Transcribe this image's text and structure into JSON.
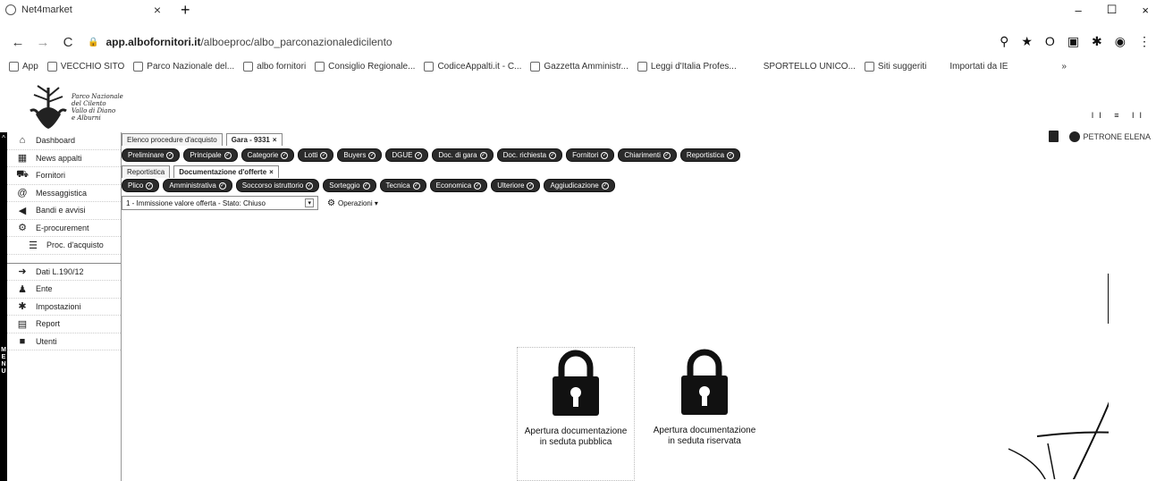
{
  "browser": {
    "tab_title": "Net4market",
    "tab_close": "×",
    "new_tab": "+",
    "url_host": "app.albofornitori.it",
    "url_path": "/alboeproc/albo_parconazionaledicilento",
    "window_controls": [
      "–",
      "☐",
      "×"
    ],
    "extensions": [
      "search-icon",
      "star-icon",
      "opera-icon",
      "ext-icon",
      "puzzle-icon",
      "profile-icon",
      "kebab-icon"
    ]
  },
  "bookmarks": [
    {
      "label": "App",
      "icon": "apps-icon"
    },
    {
      "label": "VECCHIO SITO",
      "icon": "park-icon"
    },
    {
      "label": "Parco Nazionale del...",
      "icon": "park-icon"
    },
    {
      "label": "albo fornitori",
      "icon": "globe-icon"
    },
    {
      "label": "Consiglio Regionale...",
      "icon": "eye-icon"
    },
    {
      "label": "CodiceAppalti.it - C...",
      "icon": "codice-icon"
    },
    {
      "label": "Gazzetta Amministr...",
      "icon": "ga-icon"
    },
    {
      "label": "Leggi d'Italia Profes...",
      "icon": "leggi-icon"
    },
    {
      "label": "SPORTELLO UNICO...",
      "icon": ""
    },
    {
      "label": "Siti suggeriti",
      "icon": "page-icon"
    },
    {
      "label": "Importati da IE",
      "icon": ""
    },
    {
      "label": "»",
      "icon": ""
    }
  ],
  "header": {
    "logo_lines": [
      "Parco Nazionale",
      "del Cilento",
      "Vallo di Diano",
      "e Alburni"
    ],
    "icons_text": "II ≡ II",
    "user_name": "PETRONE ELENA"
  },
  "menu": {
    "side_label": [
      "M",
      "E",
      "N",
      "U"
    ],
    "collapse": "^",
    "items": [
      {
        "label": "Dashboard",
        "icon": "⌂",
        "name": "dashboard"
      },
      {
        "label": "News appalti",
        "icon": "▦",
        "name": "news-appalti"
      },
      {
        "label": "Fornitori",
        "icon": "⛟",
        "name": "fornitori"
      },
      {
        "label": "Messaggistica",
        "icon": "@",
        "name": "messaggistica"
      },
      {
        "label": "Bandi e avvisi",
        "icon": "◀",
        "name": "bandi-e-avvisi"
      },
      {
        "label": "E-procurement",
        "icon": "⚙",
        "name": "e-procurement"
      },
      {
        "label": "Proc. d'acquisto",
        "icon": "☰",
        "name": "proc-dacquisto"
      }
    ],
    "items2": [
      {
        "label": "Dati L.190/12",
        "icon": "➜",
        "name": "dati-l-190-12"
      },
      {
        "label": "Ente",
        "icon": "♟",
        "name": "ente"
      },
      {
        "label": "Impostazioni",
        "icon": "✱",
        "name": "impostazioni"
      },
      {
        "label": "Report",
        "icon": "▤",
        "name": "report"
      },
      {
        "label": "Utenti",
        "icon": "■",
        "name": "utenti"
      }
    ]
  },
  "tabs_row1": [
    {
      "label": "Elenco procedure d'acquisto",
      "active": false,
      "closable": false
    },
    {
      "label": "Gara - 9331",
      "active": true,
      "closable": true
    }
  ],
  "tabs_row2": [
    "Preliminare",
    "Principale",
    "Categorie",
    "Lotti",
    "Buyers",
    "DGUE",
    "Doc. di gara",
    "Doc. richiesta",
    "Fornitori",
    "Chiarimenti",
    "Reportistica"
  ],
  "tabs_row3": [
    {
      "label": "Reportistica",
      "active": false,
      "closable": false
    },
    {
      "label": "Documentazione d'offerte",
      "active": true,
      "closable": true
    }
  ],
  "tabs_row4": [
    "Plico",
    "Amministrativa",
    "Soccorso istruttorio",
    "Sorteggio",
    "Tecnica",
    "Economica",
    "Ulteriore",
    "Aggiudicazione"
  ],
  "filter": {
    "selected": "1 - Immissione valore offerta - Stato: Chiuso",
    "caret": "▾",
    "operations": "Operazioni ▾"
  },
  "locks": [
    {
      "label": "Apertura documentazione in seduta pubblica"
    },
    {
      "label": "Apertura documentazione in seduta riservata"
    }
  ],
  "colors": {
    "pill_bg": "#2b2b2b",
    "sidebar_bg": "#000000"
  }
}
